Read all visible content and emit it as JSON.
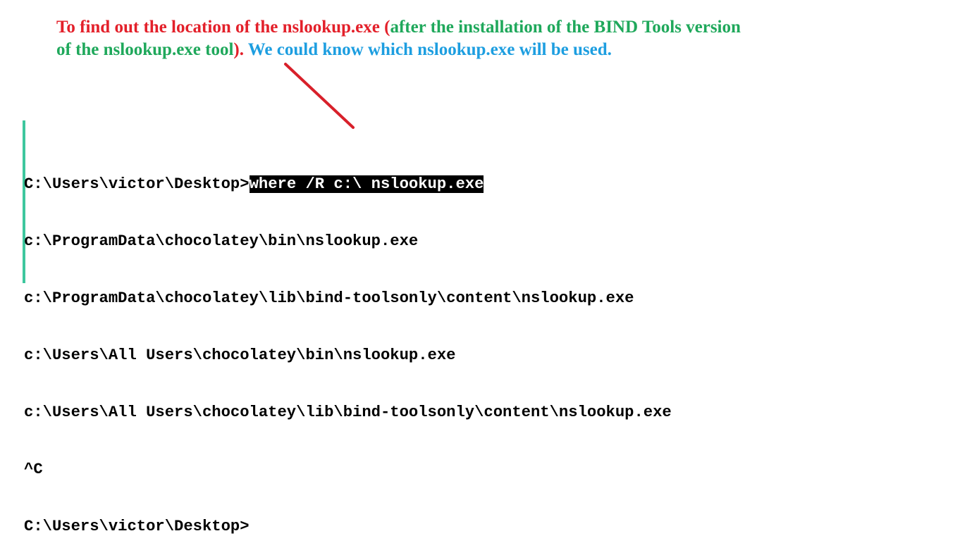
{
  "annotation": {
    "line1_red": "To find out the location of the nslookup.exe (",
    "line1_green": "after the installation of the BIND Tools version",
    "line2_green": "of the nslookup.exe tool",
    "line2_red": ").",
    "line2_blue": " We could know which nslookup.exe will be used.",
    "colors": {
      "red": "#e3202a",
      "green": "#1fa85b",
      "blue": "#1d9ee0"
    }
  },
  "arrow": {
    "color": "#d8202a"
  },
  "console": {
    "prompt": "C:\\Users\\victor\\Desktop>",
    "command": "where /R c:\\ nslookup.exe",
    "output": [
      "c:\\ProgramData\\chocolatey\\bin\\nslookup.exe",
      "c:\\ProgramData\\chocolatey\\lib\\bind-toolsonly\\content\\nslookup.exe",
      "c:\\Users\\All Users\\chocolatey\\bin\\nslookup.exe",
      "c:\\Users\\All Users\\chocolatey\\lib\\bind-toolsonly\\content\\nslookup.exe",
      "^C"
    ],
    "final_prompt": "C:\\Users\\victor\\Desktop>"
  }
}
